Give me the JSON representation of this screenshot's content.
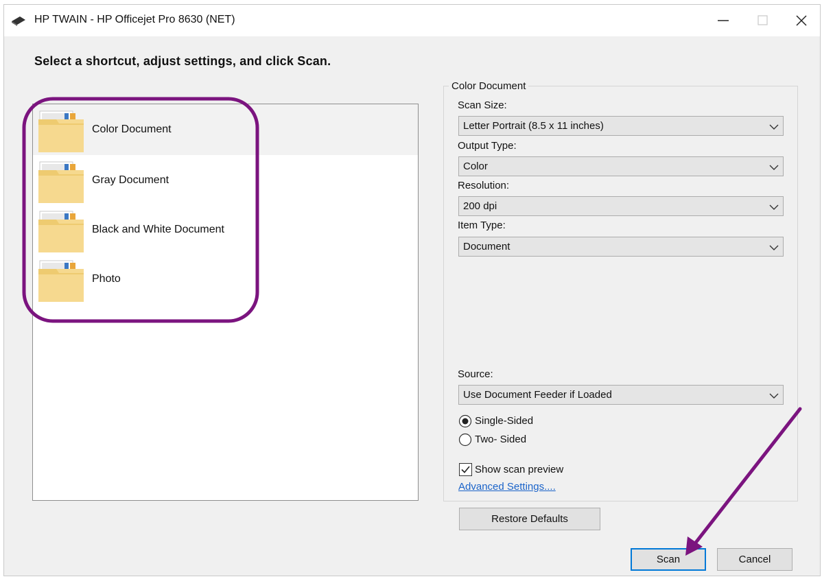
{
  "window": {
    "title": "HP TWAIN - HP Officejet Pro 8630 (NET)",
    "controls": [
      "minimize-icon",
      "maximize-icon",
      "close-icon"
    ]
  },
  "instruction": "Select a shortcut, adjust settings, and click Scan.",
  "shortcuts": [
    {
      "label": "Color Document",
      "selected": true
    },
    {
      "label": "Gray Document",
      "selected": false
    },
    {
      "label": "Black and White Document",
      "selected": false
    },
    {
      "label": "Photo",
      "selected": false
    }
  ],
  "settings": {
    "group_title": "Color Document",
    "scan_size": {
      "label": "Scan Size:",
      "value": "Letter Portrait (8.5 x 11 inches)"
    },
    "output_type": {
      "label": "Output Type:",
      "value": "Color"
    },
    "resolution": {
      "label": "Resolution:",
      "value": "200 dpi"
    },
    "item_type": {
      "label": "Item Type:",
      "value": "Document"
    },
    "source": {
      "label": "Source:",
      "value": "Use Document Feeder if Loaded"
    },
    "sides": [
      {
        "label": "Single-Sided",
        "checked": true
      },
      {
        "label": "Two- Sided",
        "checked": false
      }
    ],
    "scan_preview": {
      "label": "Show scan preview",
      "checked": true
    },
    "advanced_link": "Advanced Settings...."
  },
  "buttons": {
    "restore": "Restore Defaults",
    "scan": "Scan",
    "cancel": "Cancel"
  },
  "colors": {
    "annotation": "#7b147f",
    "link": "#1a63c9",
    "focus_border": "#0078d7",
    "window_bg": "#f0f0f0"
  }
}
